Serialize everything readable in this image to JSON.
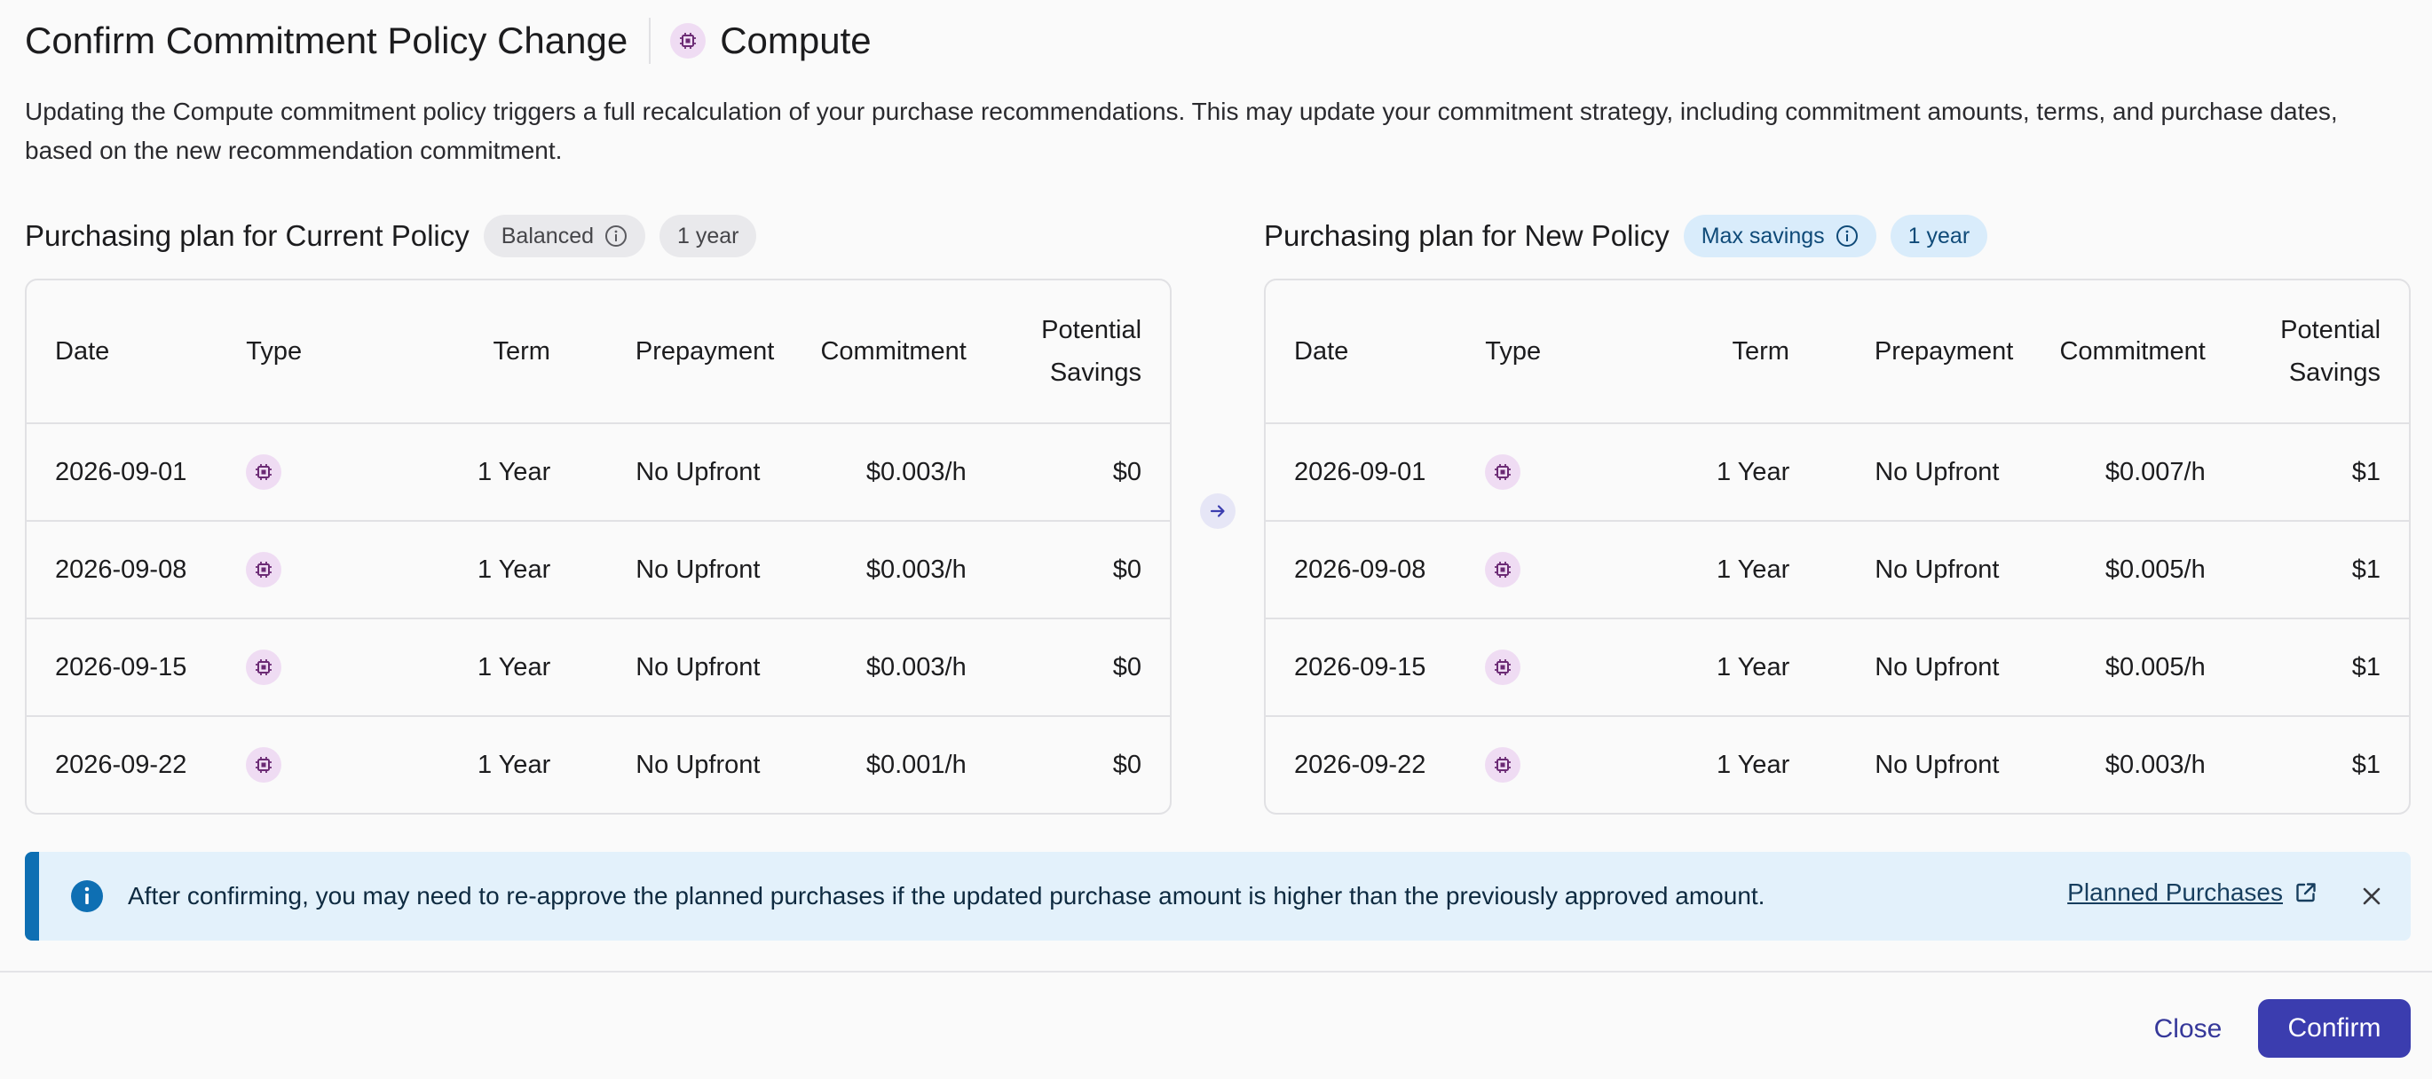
{
  "header": {
    "title": "Confirm Commitment Policy Change",
    "category_label": "Compute",
    "category_icon": "cpu-chip-icon"
  },
  "description": "Updating the Compute commitment policy triggers a full recalculation of your purchase recommendations. This may update your commitment strategy, including commitment amounts, terms, and purchase dates, based on the new recommendation commitment.",
  "columns": [
    "Date",
    "Type",
    "Term",
    "Prepayment",
    "Commitment",
    "Potential Savings"
  ],
  "current_plan": {
    "title": "Purchasing plan for Current Policy",
    "policy_badge": "Balanced",
    "term_badge": "1 year",
    "rows": [
      {
        "date": "2026-09-01",
        "type_icon": "cpu-chip-icon",
        "term": "1 Year",
        "prepayment": "No Upfront",
        "commitment": "$0.003/h",
        "savings": "$0"
      },
      {
        "date": "2026-09-08",
        "type_icon": "cpu-chip-icon",
        "term": "1 Year",
        "prepayment": "No Upfront",
        "commitment": "$0.003/h",
        "savings": "$0"
      },
      {
        "date": "2026-09-15",
        "type_icon": "cpu-chip-icon",
        "term": "1 Year",
        "prepayment": "No Upfront",
        "commitment": "$0.003/h",
        "savings": "$0"
      },
      {
        "date": "2026-09-22",
        "type_icon": "cpu-chip-icon",
        "term": "1 Year",
        "prepayment": "No Upfront",
        "commitment": "$0.001/h",
        "savings": "$0"
      }
    ]
  },
  "new_plan": {
    "title": "Purchasing plan for New Policy",
    "policy_badge": "Max savings",
    "term_badge": "1 year",
    "rows": [
      {
        "date": "2026-09-01",
        "type_icon": "cpu-chip-icon",
        "term": "1 Year",
        "prepayment": "No Upfront",
        "commitment": "$0.007/h",
        "savings": "$1"
      },
      {
        "date": "2026-09-08",
        "type_icon": "cpu-chip-icon",
        "term": "1 Year",
        "prepayment": "No Upfront",
        "commitment": "$0.005/h",
        "savings": "$1"
      },
      {
        "date": "2026-09-15",
        "type_icon": "cpu-chip-icon",
        "term": "1 Year",
        "prepayment": "No Upfront",
        "commitment": "$0.005/h",
        "savings": "$1"
      },
      {
        "date": "2026-09-22",
        "type_icon": "cpu-chip-icon",
        "term": "1 Year",
        "prepayment": "No Upfront",
        "commitment": "$0.003/h",
        "savings": "$1"
      }
    ]
  },
  "banner": {
    "text": "After confirming, you may need to re-approve the planned purchases if the updated purchase amount is higher than the previously approved amount.",
    "link_label": "Planned Purchases",
    "icon": "info-icon"
  },
  "footer": {
    "close_label": "Close",
    "confirm_label": "Confirm"
  },
  "colors": {
    "primary": "#3b3daf",
    "info_accent": "#0e6fb3",
    "info_background": "#e3f1fb",
    "compute_chip": "#efdcf3"
  }
}
